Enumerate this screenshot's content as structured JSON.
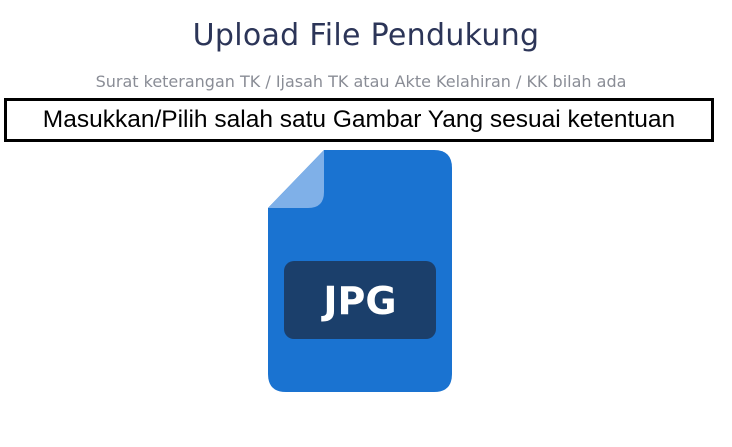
{
  "header": {
    "title": "Upload File Pendukung",
    "subtitle": "Surat keterangan TK / Ijasah TK atau Akte Kelahiran / KK bilah ada"
  },
  "upload": {
    "label": "Masukkan/Pilih salah satu Gambar Yang sesuai ketentuan",
    "preview_badge": "JPG",
    "preview_icon": "jpg-file-icon"
  },
  "colors": {
    "title": "#2c3558",
    "subtitle": "#8a8d96",
    "file_body": "#1a73d1",
    "file_fold": "#7fb0e8",
    "badge_bg": "#1b3f6b",
    "badge_text": "#ffffff"
  }
}
